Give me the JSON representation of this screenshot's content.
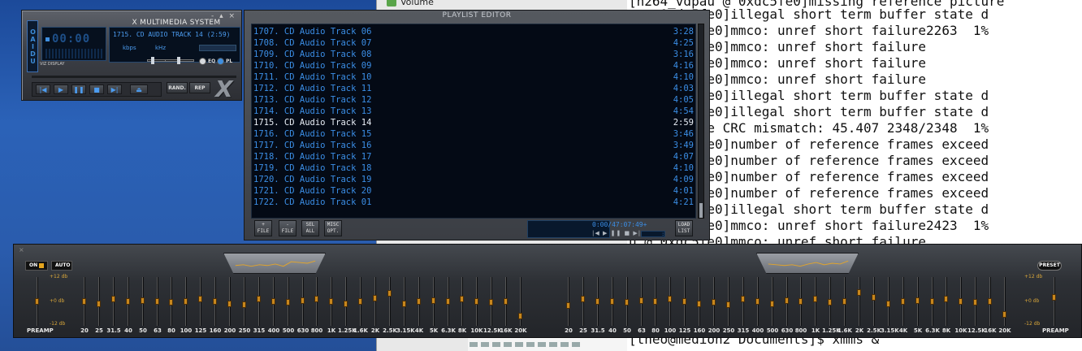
{
  "background": {
    "desktop_color": "#2a5cad",
    "file_manager": {
      "volume_label": "Volume"
    }
  },
  "terminal": {
    "lines": [
      "[h264_vdpau @ 0xdc5fe0]missing reference picture",
      "u @ 0xdc5fe0]illegal short term buffer state d",
      "u @ 0xdc5fe0]mmco: unref short failure2263  1%",
      "u @ 0xdc5fe0]mmco: unref short failure",
      "u @ 0xdc5fe0]mmco: unref short failure",
      "u @ 0xdc5fe0]mmco: unref short failure",
      "u @ 0xdc5fe0]illegal short term buffer state d",
      "u @ 0xdc5fe0]illegal short term buffer state d",
      "c5fe0]frame CRC mismatch: 45.407 2348/2348  1%",
      "u @ 0xdc5fe0]number of reference frames exceed",
      "u @ 0xdc5fe0]number of reference frames exceed",
      "u @ 0xdc5fe0]number of reference frames exceed",
      "u @ 0xdc5fe0]number of reference frames exceed",
      "u @ 0xdc5fe0]illegal short term buffer state d",
      "u @ 0xdc5fe0]mmco: unref short failure2423  1%",
      "u @ 0xdc5fe0]mmco: unref short failure",
      "d",
      "%",
      "%",
      "%",
      "[theo@medion2 Documents]$ xmms &"
    ]
  },
  "xmms_main": {
    "title": "X MULTIMEDIA SYSTEM",
    "window_buttons": "- ▴ ×",
    "sidebar_text": "OAIDU",
    "time": "00:00",
    "song_title": "1715. CD AUDIO TRACK 14 (2:59)",
    "kbps_label": "kbps",
    "khz_label": "kHz",
    "vis_label": "VIZ DISPLAY",
    "eq_label": "EQ",
    "pl_label": "PL",
    "controls": [
      "|◀",
      "▶",
      "❚❚",
      "■",
      "▶|",
      "⏏"
    ],
    "rand_label": "RAND.",
    "rep_label": "REP",
    "logo": "X"
  },
  "playlist": {
    "title": "PLAYLIST EDITOR",
    "current_index": 8,
    "tracks": [
      {
        "label": "1707. CD Audio Track 06",
        "time": "3:28"
      },
      {
        "label": "1708. CD Audio Track 07",
        "time": "4:25"
      },
      {
        "label": "1709. CD Audio Track 08",
        "time": "3:16"
      },
      {
        "label": "1710. CD Audio Track 09",
        "time": "4:16"
      },
      {
        "label": "1711. CD Audio Track 10",
        "time": "4:10"
      },
      {
        "label": "1712. CD Audio Track 11",
        "time": "4:03"
      },
      {
        "label": "1713. CD Audio Track 12",
        "time": "4:05"
      },
      {
        "label": "1714. CD Audio Track 13",
        "time": "4:54"
      },
      {
        "label": "1715. CD Audio Track 14",
        "time": "2:59"
      },
      {
        "label": "1716. CD Audio Track 15",
        "time": "3:46"
      },
      {
        "label": "1717. CD Audio Track 16",
        "time": "3:49"
      },
      {
        "label": "1718. CD Audio Track 17",
        "time": "4:07"
      },
      {
        "label": "1719. CD Audio Track 18",
        "time": "4:10"
      },
      {
        "label": "1720. CD Audio Track 19",
        "time": "4:09"
      },
      {
        "label": "1721. CD Audio Track 20",
        "time": "4:01"
      },
      {
        "label": "1722. CD Audio Track 01",
        "time": "4:21"
      }
    ],
    "buttons": [
      {
        "top": "+",
        "bottom": "FILE"
      },
      {
        "top": "-",
        "bottom": "FILE"
      },
      {
        "top": "SEL",
        "bottom": "ALL"
      },
      {
        "top": "MISC",
        "bottom": "OPT."
      },
      {
        "top": "LOAD",
        "bottom": "LIST"
      }
    ],
    "time_info": "0:00/47:07:49+",
    "mini_controls": "|◀ ▶ ❚❚ ■ ▶| ⏏",
    "mini_field": ":"
  },
  "equalizer": {
    "on_label": "ON",
    "auto_label": "AUTO",
    "preset_label": "PRESET",
    "preamp_label": "PREAMP",
    "db_plus": "+12 db",
    "db_zero": "+0 db",
    "db_minus": "-12 db",
    "accent_color": "#c8871d",
    "frequencies": [
      "20",
      "25",
      "31.5",
      "40",
      "50",
      "63",
      "80",
      "100",
      "125",
      "160",
      "200",
      "250",
      "315",
      "400",
      "500",
      "630",
      "800",
      "1K",
      "1.25K",
      "1.6K",
      "2K",
      "2.5K",
      "3.15K",
      "4K",
      "5K",
      "6.3K",
      "8K",
      "10K",
      "12.5K",
      "16K",
      "20K"
    ],
    "left_gains": [
      0.5,
      0.45,
      0.55,
      0.5,
      0.52,
      0.5,
      0.48,
      0.5,
      0.55,
      0.5,
      0.45,
      0.42,
      0.55,
      0.5,
      0.48,
      0.52,
      0.55,
      0.5,
      0.45,
      0.5,
      0.58,
      0.7,
      0.45,
      0.5,
      0.52,
      0.5,
      0.55,
      0.5,
      0.48,
      0.5,
      0.15
    ],
    "right_gains": [
      0.4,
      0.55,
      0.5,
      0.5,
      0.48,
      0.52,
      0.5,
      0.55,
      0.5,
      0.45,
      0.48,
      0.42,
      0.55,
      0.5,
      0.45,
      0.52,
      0.5,
      0.55,
      0.48,
      0.5,
      0.72,
      0.6,
      0.45,
      0.5,
      0.52,
      0.5,
      0.55,
      0.5,
      0.48,
      0.5,
      0.2
    ],
    "left_preamp": 0.5,
    "right_preamp": 0.6
  }
}
